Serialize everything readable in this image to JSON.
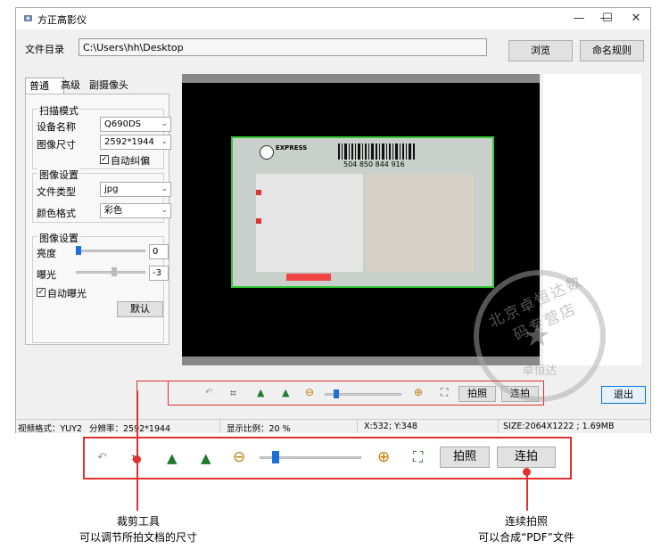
{
  "window": {
    "title": "方正高影仪",
    "minimize_glyph": "—",
    "maximize_glyph": "☐",
    "close_glyph": "✕"
  },
  "directory": {
    "label": "文件目录",
    "value": "C:\\Users\\hh\\Desktop",
    "browse_label": "浏览",
    "naming_label": "命名规则"
  },
  "tabs": [
    "普通",
    "高级",
    "副摄像头"
  ],
  "scan_mode": {
    "title": "扫描模式",
    "device_label": "设备名称",
    "device_value": "Q690DS",
    "size_label": "图像尺寸",
    "size_value": "2592*1944",
    "auto_deskew_label": "自动纠偏",
    "auto_deskew_checked": true
  },
  "image_settings": {
    "title": "图像设置",
    "file_type_label": "文件类型",
    "file_type_value": "jpg",
    "color_label": "颜色格式",
    "color_value": "彩色"
  },
  "image_adjust": {
    "title": "图像设置",
    "brightness_label": "亮度",
    "brightness_value": "0",
    "exposure_label": "曝光",
    "exposure_value": "-3",
    "auto_exposure_label": "自动曝光",
    "auto_exposure_checked": true,
    "default_label": "默认"
  },
  "preview": {
    "doc_brand": "EXPRESS",
    "doc_barcode_number": "504 850 844 916"
  },
  "toolbar": {
    "capture_label": "拍照",
    "continuous_label": "连拍",
    "zoom_level": 0.12
  },
  "exit_label": "退出",
  "status": {
    "video_format": "视频格式：YUY2",
    "resolution": "分辨率：2592*1944",
    "display_ratio": "显示比例：20 %",
    "coords": "X:532; Y:348",
    "size": "SIZE:2064X1222 ; 1.69MB"
  },
  "annotations": {
    "crop_title": "裁剪工具",
    "crop_desc": "可以调节所拍文档的尺寸",
    "burst_title": "连续拍照",
    "burst_desc": "可以合成“PDF”文件"
  },
  "watermark": {
    "top_text": "北京卓恒达数码专营店",
    "bottom_text": "卓恒达"
  },
  "colors": {
    "annotation_red": "#e03030",
    "accent_blue": "#1e6fd9",
    "doc_border_green": "#34c934"
  }
}
